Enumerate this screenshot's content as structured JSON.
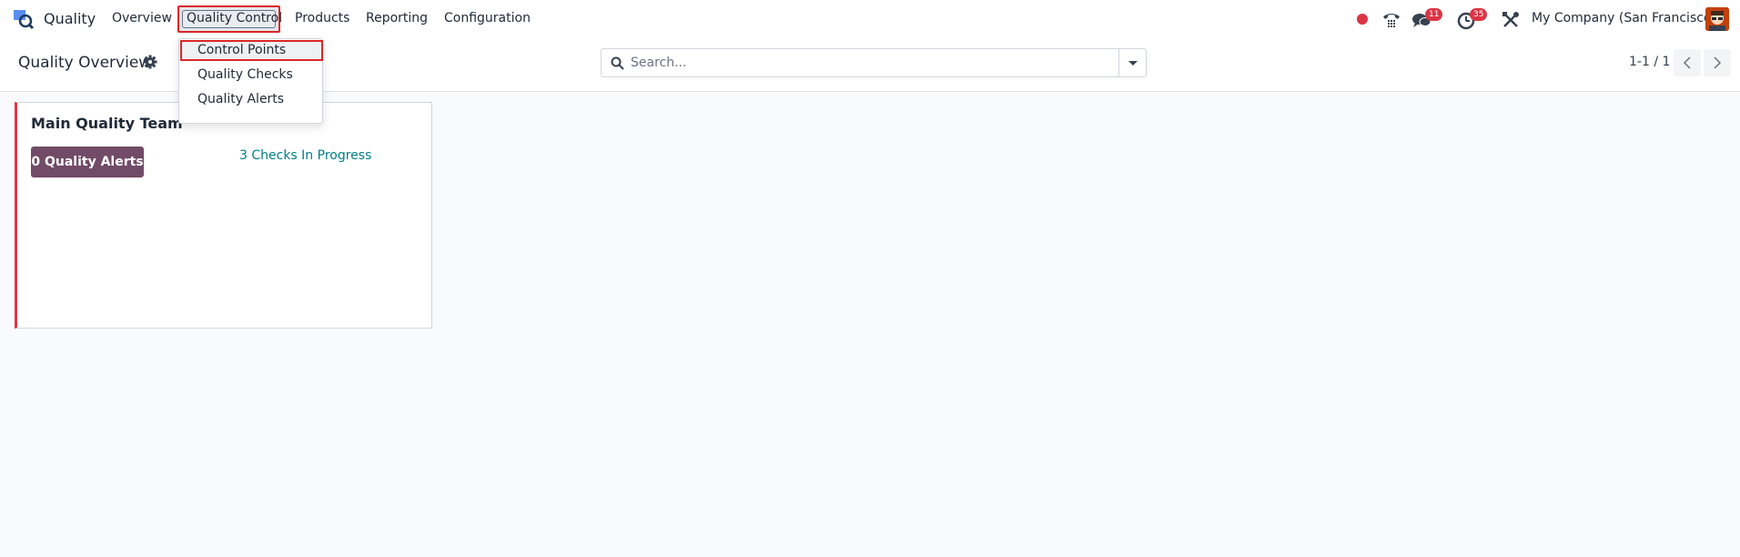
{
  "navbar": {
    "app_name": "Quality",
    "menu": [
      "Overview",
      "Quality Control",
      "Products",
      "Reporting",
      "Configuration"
    ],
    "active_menu": "Quality Control",
    "messages_badge": "11",
    "activities_badge": "35",
    "company": "My Company (San Francisco)",
    "icons": [
      "quality-app-logo",
      "record-dot",
      "phone",
      "chat",
      "clock",
      "tools",
      "avatar"
    ]
  },
  "dropdown": {
    "items": [
      "Control Points",
      "Quality Checks",
      "Quality Alerts"
    ],
    "highlighted": "Control Points"
  },
  "control_panel": {
    "title": "Quality Overview",
    "search_placeholder": "Search...",
    "pager": "1-1 / 1"
  },
  "card": {
    "title": "Main Quality Team",
    "alerts_button": "0 Quality Alerts",
    "checks_link": "3 Checks In Progress"
  },
  "colors": {
    "brand": "#714b67",
    "highlight": "#dc2626",
    "link": "#017e84",
    "badge": "#dc3545"
  }
}
